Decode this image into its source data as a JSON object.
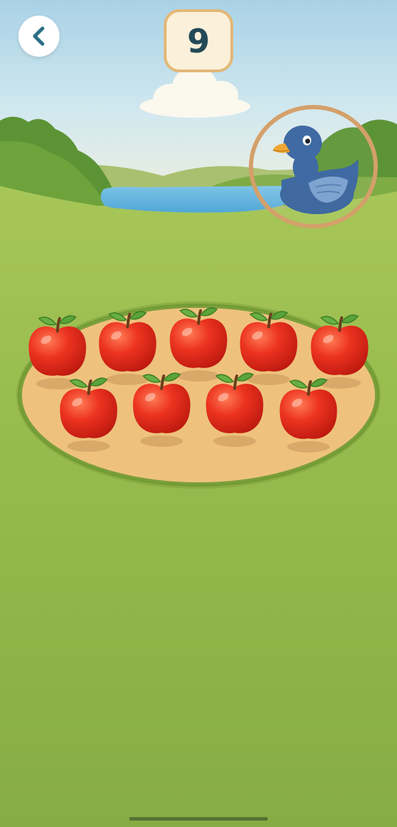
{
  "counter": {
    "value": "9"
  },
  "target": {
    "character": "duck",
    "icon": "duck-icon"
  },
  "apples": {
    "count": 9,
    "icon": "apple-icon"
  },
  "colors": {
    "sky_top": "#a9d2e7",
    "grass": "#8fb64a",
    "tray": "#eec27d",
    "apple_red": "#e42a1b",
    "ring": "#d4a06a",
    "duck_blue": "#3f6aa3",
    "counter_bg": "#fbf0d9",
    "counter_text": "#234a57"
  }
}
